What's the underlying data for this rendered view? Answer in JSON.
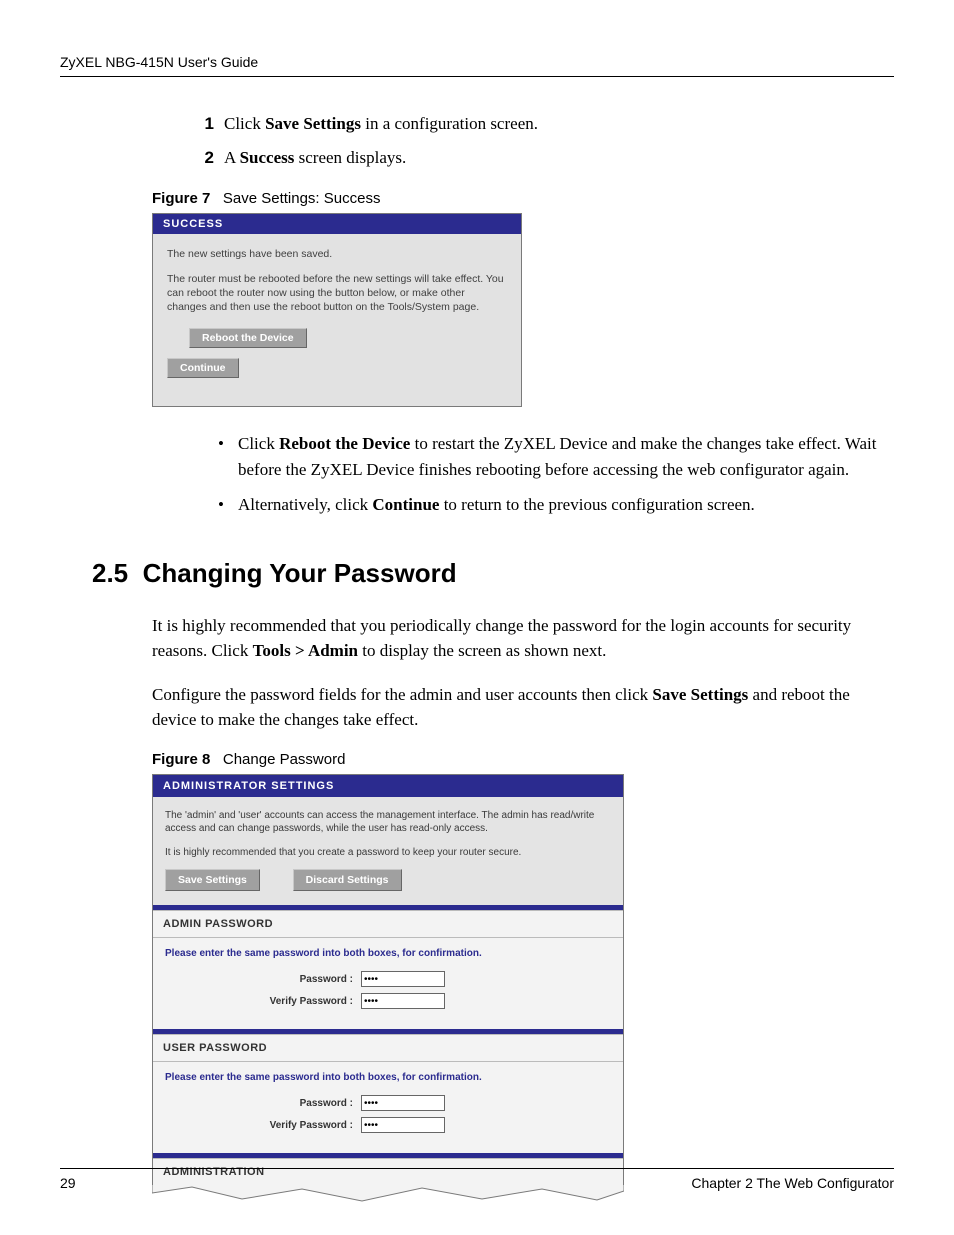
{
  "header": {
    "running": "ZyXEL NBG-415N User's Guide"
  },
  "steps": [
    {
      "num": "1",
      "pre": "Click ",
      "bold": "Save Settings",
      "post": " in a configuration screen."
    },
    {
      "num": "2",
      "pre": "A ",
      "bold": "Success",
      "post": " screen displays."
    }
  ],
  "figure7": {
    "caption_label": "Figure 7",
    "caption_text": "Save Settings: Success",
    "title": "SUCCESS",
    "saved_msg": "The new settings have been saved.",
    "reboot_msg": "The router must be rebooted before the new settings will take effect. You can reboot the router now using the button below, or make other changes and then use the reboot button on the Tools/System page.",
    "btn_reboot": "Reboot the Device",
    "btn_continue": "Continue"
  },
  "post_fig_bullets": [
    {
      "pre": "Click ",
      "bold": "Reboot the Device",
      "post": " to restart the ZyXEL Device and make the changes take effect. Wait before the ZyXEL Device finishes rebooting before accessing the web configurator again."
    },
    {
      "pre": "Alternatively, click ",
      "bold": "Continue",
      "post": " to return to the previous configuration screen."
    }
  ],
  "section": {
    "number": "2.5",
    "title": "Changing Your Password"
  },
  "para1": {
    "pre": "It is highly recommended that you periodically change the password for the login accounts for security reasons. Click ",
    "bold": "Tools > Admin",
    "post": " to display the screen as shown next."
  },
  "para2": {
    "pre": "Configure the password fields for the admin and user accounts then click ",
    "bold": "Save Settings",
    "post": " and reboot the device to make the changes take effect."
  },
  "figure8": {
    "caption_label": "Figure 8",
    "caption_text": "Change Password",
    "title": "ADMINISTRATOR SETTINGS",
    "intro1": "The 'admin' and 'user' accounts can access the management interface. The admin has read/write access and can change passwords, while the user has read-only access.",
    "intro2": "It is highly recommended that you create a password to keep your router secure.",
    "btn_save": "Save Settings",
    "btn_discard": "Discard Settings",
    "admin_header": "ADMIN PASSWORD",
    "user_header": "USER PASSWORD",
    "confirm_prompt": "Please enter the same password into both boxes, for confirmation.",
    "label_password": "Password :",
    "label_verify": "Verify Password :",
    "admin_pw_value": "••••",
    "admin_vpw_value": "••••",
    "user_pw_value": "••••",
    "user_vpw_value": "••••",
    "administration_header": "ADMINISTRATION"
  },
  "footer": {
    "page": "29",
    "chapter": "Chapter 2 The Web Configurator"
  }
}
